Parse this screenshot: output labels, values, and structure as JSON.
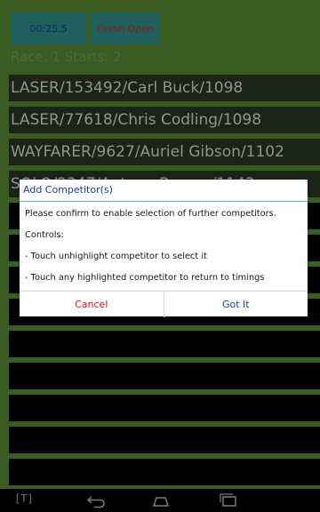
{
  "top": {
    "timer": "00:25.5",
    "finish": "Finish Open",
    "race_status": "Race: 1 Starts: 2"
  },
  "competitors": [
    "LASER/153492/Carl Buck/1098",
    "LASER/77618/Chris Codling/1098",
    "WAYFARER/9627/Auriel Gibson/1102",
    "SOLO/2347/Antony Barnes/1143"
  ],
  "dialog": {
    "title": "Add Competitor(s)",
    "line1": "Please confirm to enable selection of further competitors.",
    "line2": "Controls:",
    "line3": " - Touch unhighlight competitor to select it",
    "line4": " - Touch any highlighted competitor to return to timings",
    "cancel": "Cancel",
    "ok": "Got It"
  },
  "nav": {
    "t_label": "[T]"
  }
}
